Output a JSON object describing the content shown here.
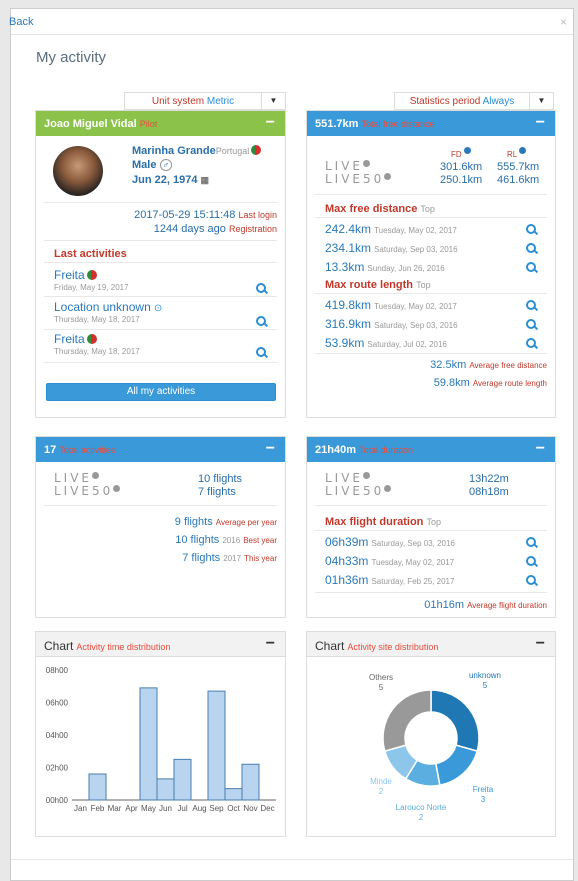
{
  "back_label": "Back",
  "close_label": "×",
  "page_title": "My activity",
  "unit_selector": {
    "label": "Unit system",
    "value": "Metric"
  },
  "period_selector": {
    "label": "Statistics period",
    "value": "Always"
  },
  "profile": {
    "name": "Joao Miguel Vidal",
    "badge": "Pilot",
    "minus": "−",
    "location": "Marinha Grande",
    "country": "Portugal",
    "gender": "Male",
    "gender_symbol": "♂",
    "birthday": "Jun 22, 1974",
    "last_login_value": "2017-05-29 15:11:48",
    "last_login_label": "Last login",
    "registration_value": "1244 days ago",
    "registration_label": "Registration",
    "last_activities_title": "Last activities",
    "activities": [
      {
        "site": "Freita",
        "date": "Friday, May 19, 2017"
      },
      {
        "site": "Location unknown",
        "date": "Thursday, May 18, 2017"
      },
      {
        "site": "Freita",
        "date": "Thursday, May 18, 2017"
      }
    ],
    "all_button": "All my activities"
  },
  "distance": {
    "value": "551.7km",
    "label": "Total free distance",
    "minus": "−",
    "fd_header": "FD",
    "rl_header": "RL",
    "live_fd": "301.6km",
    "live_rl": "555.7km",
    "live50_fd": "250.1km",
    "live50_rl": "461.6km",
    "max_free_title": "Max free distance",
    "top": "Top",
    "max_free": [
      {
        "value": "242.4km",
        "date": "Tuesday, May 02, 2017"
      },
      {
        "value": "234.1km",
        "date": "Saturday, Sep 03, 2016"
      },
      {
        "value": "13.3km",
        "date": "Sunday, Jun 26, 2016"
      }
    ],
    "max_route_title": "Max route length",
    "max_route": [
      {
        "value": "419.8km",
        "date": "Tuesday, May 02, 2017"
      },
      {
        "value": "316.9km",
        "date": "Saturday, Sep 03, 2016"
      },
      {
        "value": "53.9km",
        "date": "Saturday, Jul 02, 2016"
      }
    ],
    "avg_free_value": "32.5km",
    "avg_free_label": "Average free distance",
    "avg_route_value": "59.8km",
    "avg_route_label": "Average route length"
  },
  "activities_panel": {
    "value": "17",
    "label": "Total activities",
    "minus": "−",
    "live_flights": "10 flights",
    "live50_flights": "7 flights",
    "per_year_value": "9 flights",
    "per_year_label": "Average per year",
    "best_value": "10 flights",
    "best_year": "2016",
    "best_label": "Best year",
    "this_value": "7 flights",
    "this_year": "2017",
    "this_label": "This year"
  },
  "duration_panel": {
    "value": "21h40m",
    "label": "Total duration",
    "minus": "−",
    "live_dur": "13h22m",
    "live50_dur": "08h18m",
    "max_title": "Max flight duration",
    "top": "Top",
    "max": [
      {
        "value": "06h39m",
        "date": "Saturday, Sep 03, 2016"
      },
      {
        "value": "04h33m",
        "date": "Tuesday, May 02, 2017"
      },
      {
        "value": "01h36m",
        "date": "Saturday, Feb 25, 2017"
      }
    ],
    "avg_value": "01h16m",
    "avg_label": "Average flight duration"
  },
  "live_logo": "LIVE",
  "live50_logo": "LIVE50",
  "chart_time_header": {
    "title": "Chart",
    "sub": "Activity time distribution",
    "minus": "−"
  },
  "chart_site_header": {
    "title": "Chart",
    "sub": "Activity site distribution",
    "minus": "−"
  },
  "colors": {
    "accent": "#3a9ad9",
    "green": "#8bc34a",
    "red": "#c0392b",
    "bar": "#b8d4ee"
  },
  "chart_data": [
    {
      "type": "bar",
      "title": "Activity time distribution",
      "categories": [
        "Jan",
        "Feb",
        "Mar",
        "Apr",
        "May",
        "Jun",
        "Jul",
        "Aug",
        "Sep",
        "Oct",
        "Nov",
        "Dec"
      ],
      "values": [
        0,
        1.6,
        0,
        0,
        6.9,
        1.3,
        2.5,
        0,
        6.7,
        0.7,
        2.2,
        0
      ],
      "ytick_labels": [
        "00h00",
        "02h00",
        "04h00",
        "06h00",
        "08h00"
      ],
      "ylim": [
        0,
        8
      ]
    },
    {
      "type": "pie",
      "title": "Activity site distribution",
      "labels": [
        "unknown",
        "Freita",
        "Larouco Norte",
        "Minde",
        "Others"
      ],
      "values": [
        5,
        3,
        2,
        2,
        5
      ],
      "colors": [
        "#1f77b4",
        "#3a9ad9",
        "#5aaee0",
        "#8cc6ea",
        "#999999"
      ]
    }
  ]
}
